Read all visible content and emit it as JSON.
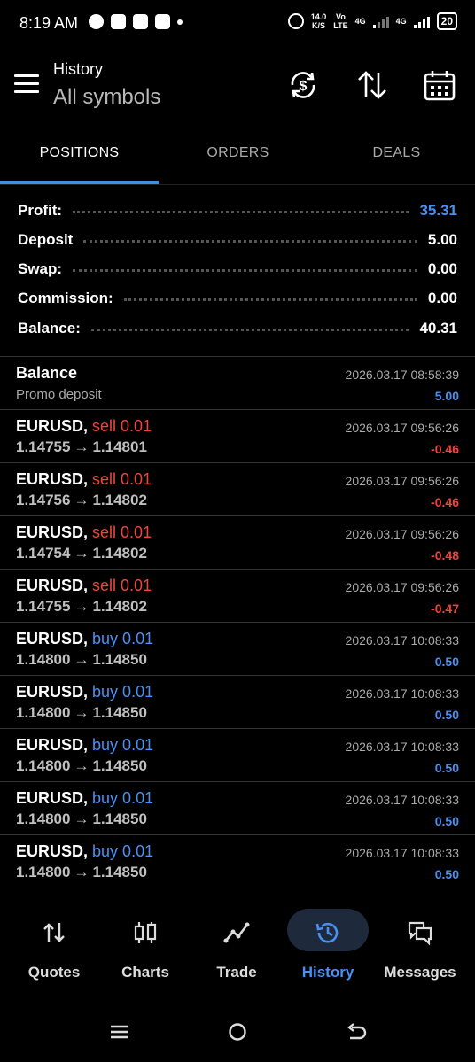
{
  "status_bar": {
    "time": "8:19 AM",
    "net_speed_top": "14.0",
    "net_speed_bottom": "K/S",
    "vo_top": "Vo",
    "vo_bottom": "LTE",
    "sig1": "4G",
    "sig2": "4G",
    "battery": "20"
  },
  "header": {
    "title": "History",
    "subtitle": "All symbols",
    "icons": [
      "menu-icon",
      "currency-sync-icon",
      "sort-icon",
      "calendar-icon"
    ]
  },
  "tabs": [
    {
      "label": "POSITIONS",
      "active": true
    },
    {
      "label": "ORDERS",
      "active": false
    },
    {
      "label": "DEALS",
      "active": false
    }
  ],
  "summary": [
    {
      "label": "Profit:",
      "value": "35.31",
      "accent": true
    },
    {
      "label": "Deposit",
      "value": "5.00",
      "accent": false
    },
    {
      "label": "Swap:",
      "value": "0.00",
      "accent": false
    },
    {
      "label": "Commission:",
      "value": "0.00",
      "accent": false
    },
    {
      "label": "Balance:",
      "value": "40.31",
      "accent": false
    }
  ],
  "balance_row": {
    "title": "Balance",
    "subtitle": "Promo deposit",
    "time": "2026.03.17 08:58:39",
    "amount": "5.00"
  },
  "positions": [
    {
      "symbol": "EURUSD,",
      "side": "sell 0.01",
      "type": "sell",
      "open": "1.14755",
      "arrow": "→",
      "close": "1.14801",
      "time": "2026.03.17 09:56:26",
      "profit": "-0.46"
    },
    {
      "symbol": "EURUSD,",
      "side": "sell 0.01",
      "type": "sell",
      "open": "1.14756",
      "arrow": "→",
      "close": "1.14802",
      "time": "2026.03.17 09:56:26",
      "profit": "-0.46"
    },
    {
      "symbol": "EURUSD,",
      "side": "sell 0.01",
      "type": "sell",
      "open": "1.14754",
      "arrow": "→",
      "close": "1.14802",
      "time": "2026.03.17 09:56:26",
      "profit": "-0.48"
    },
    {
      "symbol": "EURUSD,",
      "side": "sell 0.01",
      "type": "sell",
      "open": "1.14755",
      "arrow": "→",
      "close": "1.14802",
      "time": "2026.03.17 09:56:26",
      "profit": "-0.47"
    },
    {
      "symbol": "EURUSD,",
      "side": "buy 0.01",
      "type": "buy",
      "open": "1.14800",
      "arrow": "→",
      "close": "1.14850",
      "time": "2026.03.17 10:08:33",
      "profit": "0.50"
    },
    {
      "symbol": "EURUSD,",
      "side": "buy 0.01",
      "type": "buy",
      "open": "1.14800",
      "arrow": "→",
      "close": "1.14850",
      "time": "2026.03.17 10:08:33",
      "profit": "0.50"
    },
    {
      "symbol": "EURUSD,",
      "side": "buy 0.01",
      "type": "buy",
      "open": "1.14800",
      "arrow": "→",
      "close": "1.14850",
      "time": "2026.03.17 10:08:33",
      "profit": "0.50"
    },
    {
      "symbol": "EURUSD,",
      "side": "buy 0.01",
      "type": "buy",
      "open": "1.14800",
      "arrow": "→",
      "close": "1.14850",
      "time": "2026.03.17 10:08:33",
      "profit": "0.50"
    },
    {
      "symbol": "EURUSD,",
      "side": "buy 0.01",
      "type": "buy",
      "open": "1.14800",
      "arrow": "→",
      "close": "1.14850",
      "time": "2026.03.17 10:08:33",
      "profit": "0.50"
    }
  ],
  "bottom_nav": [
    {
      "label": "Quotes",
      "icon": "quotes-icon",
      "active": false
    },
    {
      "label": "Charts",
      "icon": "charts-icon",
      "active": false
    },
    {
      "label": "Trade",
      "icon": "trade-icon",
      "active": false
    },
    {
      "label": "History",
      "icon": "history-icon",
      "active": true
    },
    {
      "label": "Messages",
      "icon": "messages-icon",
      "active": false
    }
  ],
  "colors": {
    "accent": "#4a8ff2",
    "loss": "#f0443b",
    "background": "#000000"
  }
}
